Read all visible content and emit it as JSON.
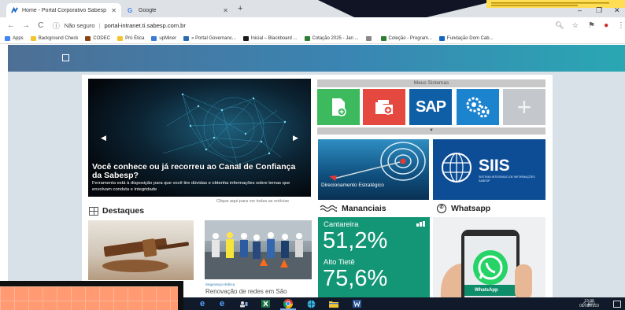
{
  "browser": {
    "tabs": [
      {
        "title": "Home - Portal Corporativo Sabesp",
        "active": true
      },
      {
        "title": "Google",
        "active": false
      }
    ],
    "new_tab": "+",
    "window_controls": [
      "–",
      "❐",
      "✕"
    ],
    "security_label": "Não seguro",
    "url": "portal-intranet.ti.sabesp.com.br",
    "bookmarks": [
      {
        "label": "Apps",
        "color": "#4285f4"
      },
      {
        "label": "Background Check",
        "color": "#f4c430"
      },
      {
        "label": "CODEC",
        "color": "#8b4513"
      },
      {
        "label": "Pró Ética",
        "color": "#f4c430"
      },
      {
        "label": "upMiner",
        "color": "#3a7bd5"
      },
      {
        "label": "» Portal Governanc...",
        "color": "#2a6ab0"
      },
      {
        "label": "Inicial – Blackboard ...",
        "color": "#1a1a1a"
      },
      {
        "label": "Cotação 2025 - Jan ...",
        "color": "#2e7d32"
      },
      {
        "label": "",
        "color": "#888888"
      },
      {
        "label": "Coleção - Program...",
        "color": "#2e7d32"
      },
      {
        "label": "Fundação Dom Cab...",
        "color": "#1565c0"
      }
    ]
  },
  "portal": {
    "slider": {
      "headline": "Você conhece ou já recorreu ao Canal de Confiança da Sabesp?",
      "subtitle": "Ferramenta está à disposição para que você tire dúvidas e obtenha informações sobre temas que envolvam conduta e integridade",
      "see_all": "Clique aqui para ver todas as notícias"
    },
    "destaques": {
      "title": "Destaques",
      "item_tag": "Segurança Hídrica",
      "item_caption": "Renovação de redes em São"
    },
    "meus_sistemas": {
      "title": "Meus Sistemas",
      "tiles": [
        {
          "name": "document-add",
          "color": "#3dba5e"
        },
        {
          "name": "folder-add",
          "color": "#e5483f"
        },
        {
          "name": "sap",
          "color": "#0f5fa6",
          "label": "SAP"
        },
        {
          "name": "settings",
          "color": "#1c84cf"
        },
        {
          "name": "add",
          "color": "#c4c8cc",
          "label": "+"
        }
      ],
      "expand": "▼"
    },
    "banners": {
      "direcionamento": "Direcionamento Estratégico",
      "siis_title": "SIIS",
      "siis_subtitle": "SISTEMA INTEGRADO DE INFORMAÇÕES SABESP"
    },
    "mananciais": {
      "title": "Mananciais",
      "items": [
        {
          "name": "Cantareira",
          "value": "51,2%"
        },
        {
          "name": "Alto Tietê",
          "value": "75,6%"
        }
      ]
    },
    "whatsapp": {
      "title": "Whatsapp",
      "phone_label": "WhatsApp"
    }
  },
  "taskbar": {
    "tray": "^ 🔊)",
    "time": "19:38",
    "date": "08/03/2019"
  }
}
